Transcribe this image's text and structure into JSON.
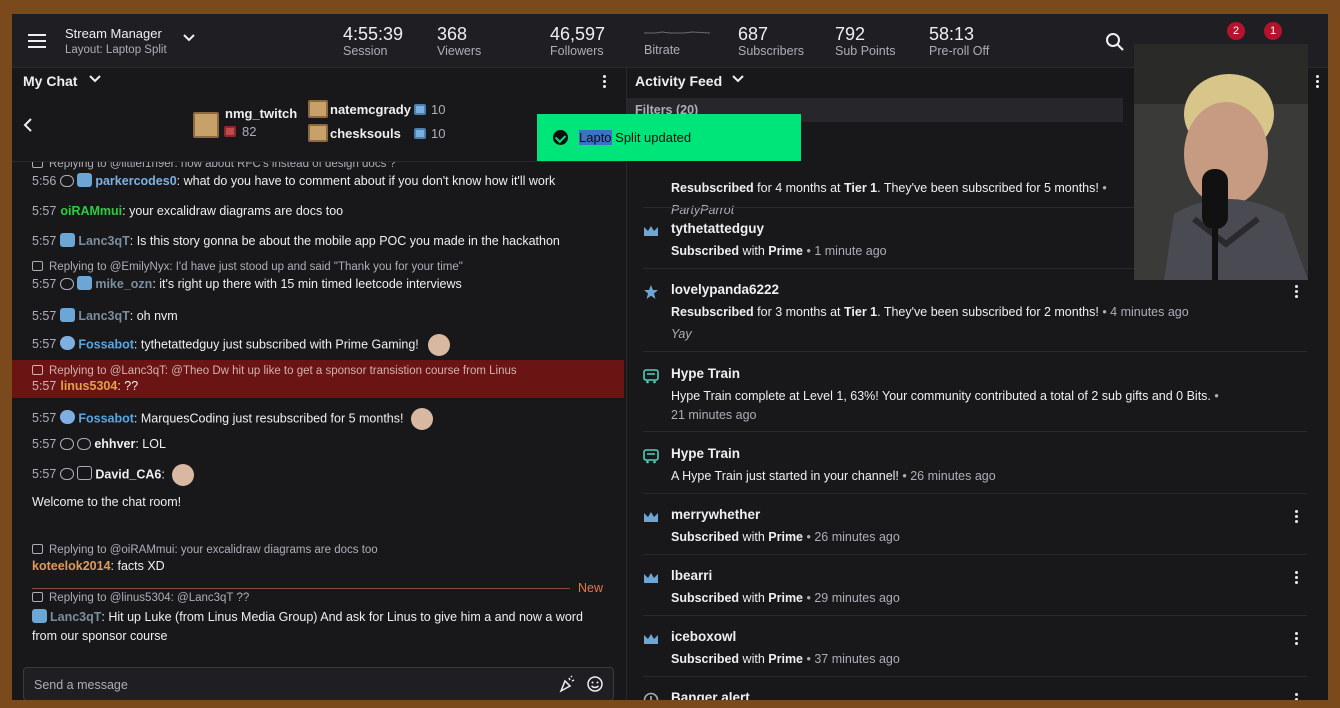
{
  "header": {
    "title": "Stream Manager",
    "layout": "Layout: Laptop Split",
    "stats": [
      {
        "value": "4:55:39",
        "label": "Session"
      },
      {
        "value": "368",
        "label": "Viewers"
      },
      {
        "value": "46,597",
        "label": "Followers"
      },
      {
        "value": "",
        "label": "Bitrate"
      },
      {
        "value": "687",
        "label": "Subscribers"
      },
      {
        "value": "792",
        "label": "Sub Points"
      },
      {
        "value": "58:13",
        "label": "Pre-roll Off"
      }
    ],
    "notif_counts": [
      "2",
      "1"
    ]
  },
  "chat": {
    "title": "My Chat",
    "gifters": [
      {
        "name": "nmg_twitch",
        "count": "82",
        "rank": "1"
      },
      {
        "name": "natemcgrady",
        "count": "10",
        "rank": "2"
      },
      {
        "name": "chesksouls",
        "count": "10",
        "rank": "3"
      }
    ],
    "messages": [
      {
        "reply": "Replying to @littlef1n9er: how about RFC's instead of design docs ?",
        "time": "5:56",
        "user": "parkercodes0",
        "text": ": what do you have to comment about if you don't know how it'll work",
        "color": "#7fb2e0"
      },
      {
        "time": "5:57",
        "user": "oiRAMmui",
        "text": ": your excalidraw diagrams are docs too",
        "color": "#2ecc40"
      },
      {
        "time": "5:57",
        "user": "Lanc3qT",
        "text": ": Is this story gonna be about the mobile app POC you made in the hackathon",
        "color": "#7b8e9e"
      },
      {
        "reply": "Replying to @EmilyNyx: I'd have just stood up and said \"Thank you for your time\"",
        "time": "5:57",
        "user": "mike_ozn",
        "text": ": it's right up there with 15 min timed leetcode interviews",
        "color": "#7b8e9e"
      },
      {
        "time": "5:57",
        "user": "Lanc3qT",
        "text": ": oh nvm",
        "color": "#7b8e9e"
      },
      {
        "time": "5:57",
        "user": "Fossabot",
        "text": ": tythetattedguy just subscribed with Prime Gaming!",
        "color": "#5aa6e0"
      },
      {
        "reply": "Replying to @Lanc3qT: @Theo Dw hit up like to get a sponsor transistion course from Linus",
        "time": "5:57",
        "user": "linus5304",
        "text": ": ??",
        "color": "#e0a050"
      },
      {
        "time": "5:57",
        "user": "Fossabot",
        "text": ": MarquesCoding just resubscribed for 5 months!",
        "color": "#5aa6e0"
      },
      {
        "time": "5:57",
        "user": "ehhver",
        "text": ": LOL",
        "color": "#efeff1"
      },
      {
        "time": "5:57",
        "user": "David_CA6",
        "text": ":",
        "color": "#efeff1"
      }
    ],
    "welcome": "Welcome to the chat room!",
    "new_label": "New",
    "after_new": [
      {
        "reply": "Replying to @oiRAMmui: your excalidraw diagrams are docs too",
        "user": "koteelok2014",
        "text": ": facts XD",
        "color": "#e09a5c"
      },
      {
        "reply": "Replying to @linus5304: @Lanc3qT ??",
        "user": "Lanc3qT",
        "text": ": Hit up Luke (from Linus Media Group) And ask for Linus to give him a and now a word from our sponsor course",
        "color": "#7b8e9e"
      }
    ],
    "input_placeholder": "Send a message"
  },
  "toast": {
    "selected": "Lapto",
    "rest": " Split updated"
  },
  "feed": {
    "title": "Activity Feed",
    "filters": "Filters (20)",
    "items": [
      {
        "icon": "crown",
        "name": "",
        "action_bold": "Resubscribed",
        "action": " for 4 months at ",
        "tier": "Tier 1",
        "rest": ". They've been subscribed for 5 months!",
        "time": " •",
        "message": "PartyParrot"
      },
      {
        "icon": "crown",
        "name": "tythetattedguy",
        "action_bold": "Subscribed",
        "action": " with ",
        "tier": "Prime",
        "rest": "",
        "time": " • 1 minute ago",
        "message": ""
      },
      {
        "icon": "star",
        "name": "lovelypanda6222",
        "action_bold": "Resubscribed",
        "action": " for 3 months at ",
        "tier": "Tier 1",
        "rest": ". They've been subscribed for 2 months!",
        "time": " • 4 minutes ago",
        "message": "Yay"
      },
      {
        "icon": "train",
        "name": "Hype Train",
        "action_bold": "",
        "action": "Hype Train complete at Level 1, 63%! Your community contributed a total of 2 sub gifts and 0 Bits.",
        "tier": "",
        "rest": "",
        "time": " • 21 minutes ago",
        "message": ""
      },
      {
        "icon": "train",
        "name": "Hype Train",
        "action_bold": "",
        "action": "A Hype Train just started in your channel!",
        "tier": "",
        "rest": "",
        "time": " • 26 minutes ago",
        "message": ""
      },
      {
        "icon": "crown",
        "name": "merrywhether",
        "action_bold": "Subscribed",
        "action": " with ",
        "tier": "Prime",
        "rest": "",
        "time": " • 26 minutes ago",
        "message": ""
      },
      {
        "icon": "crown",
        "name": "lbearri",
        "action_bold": "Subscribed",
        "action": " with ",
        "tier": "Prime",
        "rest": "",
        "time": " • 29 minutes ago",
        "message": ""
      },
      {
        "icon": "crown",
        "name": "iceboxowl",
        "action_bold": "Subscribed",
        "action": " with ",
        "tier": "Prime",
        "rest": "",
        "time": " • 37 minutes ago",
        "message": ""
      },
      {
        "icon": "clock",
        "name": "Banger alert",
        "action_bold": "",
        "action": "",
        "tier": "",
        "rest": "",
        "time": "",
        "message": ""
      }
    ]
  },
  "colors": {
    "accent": "#00e57a",
    "highlight": "#6b1414",
    "link": "#5aa6e0",
    "background": "#18181b"
  }
}
